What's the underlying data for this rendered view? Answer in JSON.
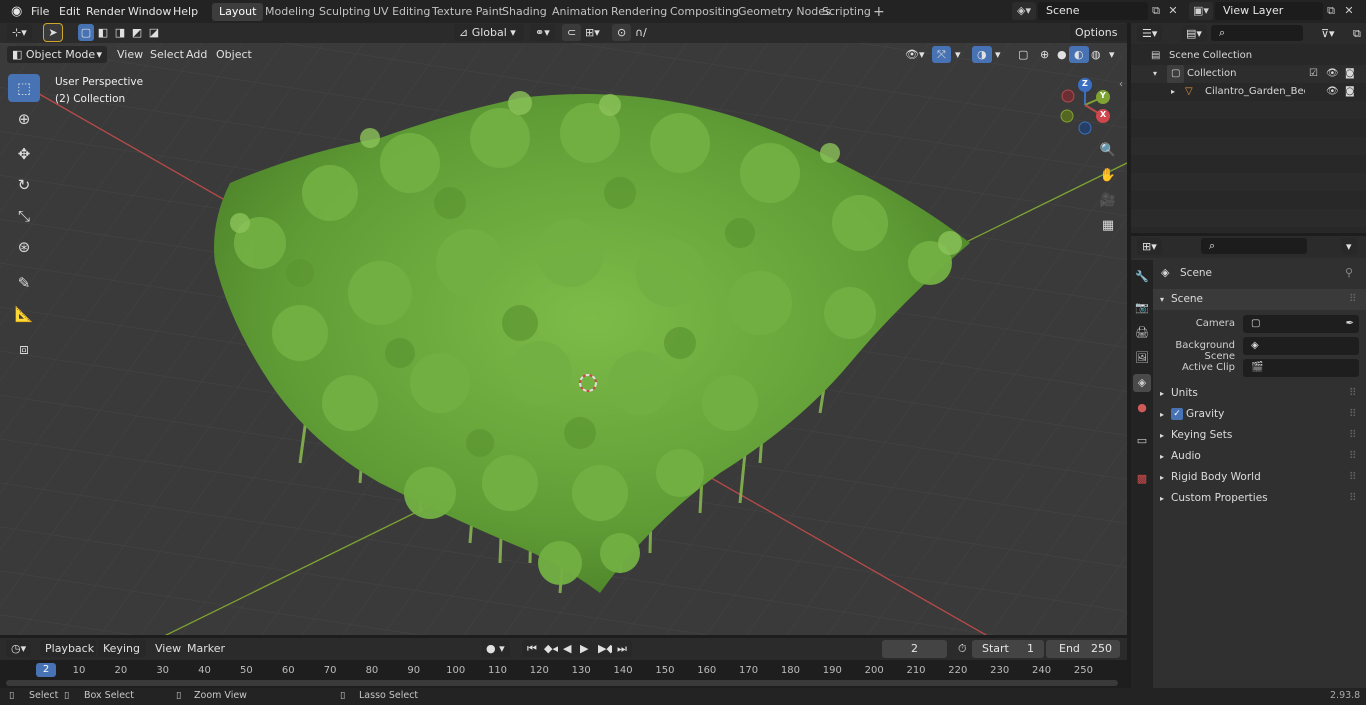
{
  "app": {
    "menus": [
      "File",
      "Edit",
      "Render",
      "Window",
      "Help"
    ],
    "workspaces": [
      "Layout",
      "Modeling",
      "Sculpting",
      "UV Editing",
      "Texture Paint",
      "Shading",
      "Animation",
      "Rendering",
      "Compositing",
      "Geometry Nodes",
      "Scripting"
    ],
    "active_workspace": "Layout",
    "add_workspace": "+",
    "scene_name": "Scene",
    "view_layer": "View Layer",
    "version": "2.93.8"
  },
  "viewport": {
    "mode": "Object Mode",
    "menus": [
      "View",
      "Select",
      "Add",
      "Object"
    ],
    "transform_orientation": "Global",
    "options_label": "Options",
    "overlay_title": "User Perspective",
    "overlay_subtitle": "(2) Collection",
    "gizmo_axes": [
      "Z",
      "Y",
      "X"
    ]
  },
  "outliner": {
    "scene_collection": "Scene Collection",
    "collection": "Collection",
    "object": "Cilantro_Garden_Bed_ob"
  },
  "properties": {
    "header": "Scene",
    "section": "Scene",
    "camera_label": "Camera",
    "background_scene_label": "Background Scene",
    "active_clip_label": "Active Clip",
    "panels": [
      "Units",
      "Gravity",
      "Keying Sets",
      "Audio",
      "Rigid Body World",
      "Custom Properties"
    ]
  },
  "timeline": {
    "menus": [
      "Playback",
      "Keying",
      "View",
      "Marker"
    ],
    "current_frame": "2",
    "start_label": "Start",
    "start_value": "1",
    "end_label": "End",
    "end_value": "250",
    "ruler": [
      "10",
      "20",
      "30",
      "40",
      "50",
      "60",
      "70",
      "80",
      "90",
      "100",
      "110",
      "120",
      "130",
      "140",
      "150",
      "160",
      "170",
      "180",
      "190",
      "200",
      "210",
      "220",
      "230",
      "240",
      "250"
    ],
    "playhead": "2"
  },
  "statusbar": {
    "select": "Select",
    "box_select": "Box Select",
    "zoom_view": "Zoom View",
    "lasso_select": "Lasso Select"
  },
  "colors": {
    "accent": "#4772b3",
    "x_axis": "#b84a4a",
    "y_axis": "#7fa332",
    "plant": "#6fae3f"
  }
}
